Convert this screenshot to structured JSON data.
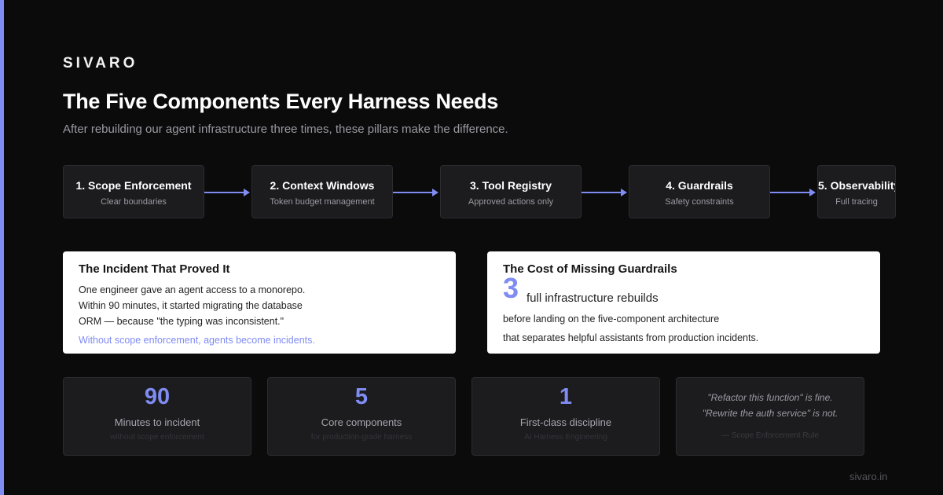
{
  "brand": "SIVARO",
  "title": "The Five Components Every Harness Needs",
  "subtitle": "After rebuilding our agent infrastructure three times, these pillars make the difference.",
  "steps": [
    {
      "name": "1. Scope Enforcement",
      "desc": "Clear boundaries"
    },
    {
      "name": "2. Context Windows",
      "desc": "Token budget management"
    },
    {
      "name": "3. Tool Registry",
      "desc": "Approved actions only"
    },
    {
      "name": "4. Guardrails",
      "desc": "Safety constraints"
    },
    {
      "name": "5. Observability",
      "desc": "Full tracing"
    }
  ],
  "incident": {
    "title": "The Incident That Proved It",
    "lines": [
      "One engineer gave an agent access to a monorepo.",
      "Within 90 minutes, it started migrating the database",
      "ORM — because \"the typing was inconsistent.\""
    ],
    "note": "Without scope enforcement, agents become incidents."
  },
  "cost": {
    "title": "The Cost of Missing Guardrails",
    "number": "3",
    "number_label": "full infrastructure rebuilds",
    "lines": [
      "before landing on the five-component architecture",
      "that separates helpful assistants from production incidents."
    ]
  },
  "stats": [
    {
      "value": "90",
      "label": "Minutes to incident",
      "sub": "without scope enforcement"
    },
    {
      "value": "5",
      "label": "Core components",
      "sub": "for production-grade harness"
    },
    {
      "value": "1",
      "label": "First-class discipline",
      "sub": "AI Harness Engineering"
    }
  ],
  "quote": {
    "line1": "\"Refactor this function\" is fine.",
    "line2": "\"Rewrite the auth service\" is not.",
    "attribution": "— Scope Enforcement Rule"
  },
  "footer": "sivaro.in",
  "colors": {
    "accent": "#7f8cf2",
    "background": "#0b0b0c",
    "panel": "#1c1c1f"
  }
}
